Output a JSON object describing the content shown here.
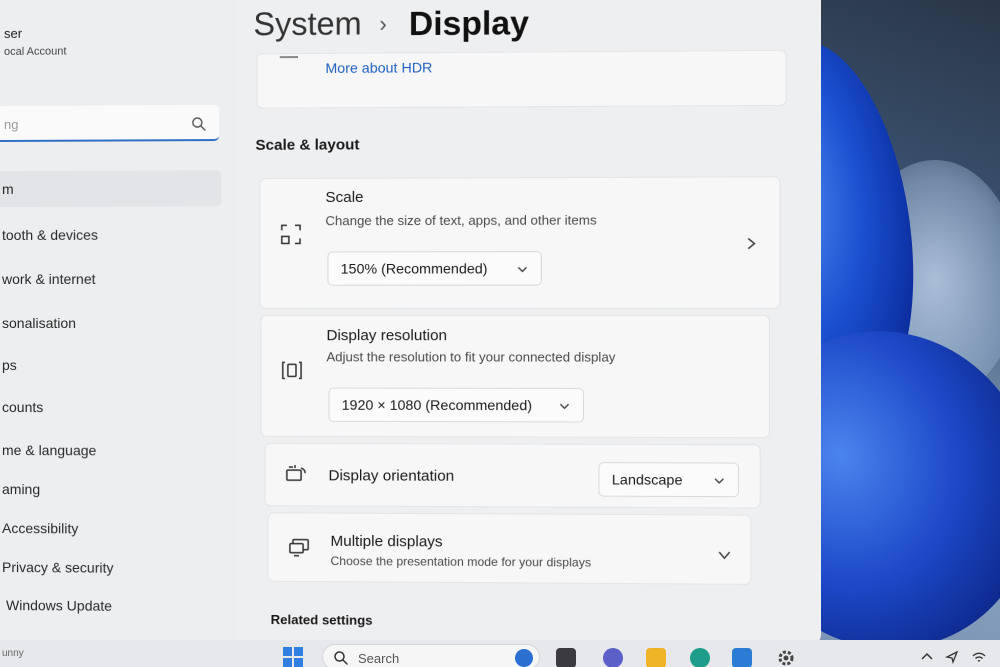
{
  "user": {
    "name": "ser",
    "account": "ocal Account"
  },
  "search": {
    "placeholder": "ng"
  },
  "nav": [
    {
      "label": "m"
    },
    {
      "label": "tooth & devices"
    },
    {
      "label": "work & internet"
    },
    {
      "label": "sonalisation"
    },
    {
      "label": "ps"
    },
    {
      "label": "counts"
    },
    {
      "label": "me & language"
    },
    {
      "label": "aming"
    },
    {
      "label": "Accessibility"
    },
    {
      "label": "Privacy & security"
    },
    {
      "label": "Windows Update"
    }
  ],
  "breadcrumb": {
    "root": "System",
    "separator": "›",
    "page": "Display"
  },
  "hdr": {
    "link": "More about HDR"
  },
  "section": {
    "title": "Scale & layout"
  },
  "scale": {
    "title": "Scale",
    "desc": "Change the size of text, apps, and other items",
    "value": "150% (Recommended)"
  },
  "resolution": {
    "title": "Display resolution",
    "desc": "Adjust the resolution to fit your connected display",
    "value": "1920 × 1080 (Recommended)"
  },
  "orientation": {
    "title": "Display orientation",
    "value": "Landscape"
  },
  "multiple": {
    "title": "Multiple displays",
    "desc": "Choose the presentation mode for your displays"
  },
  "related": {
    "title": "Related settings"
  },
  "taskbar": {
    "left_text": "unny",
    "search_label": "Search"
  },
  "colors": {
    "accent": "#2f6fc6",
    "link": "#1f5fbf",
    "window_bg": "#eeeff1"
  }
}
